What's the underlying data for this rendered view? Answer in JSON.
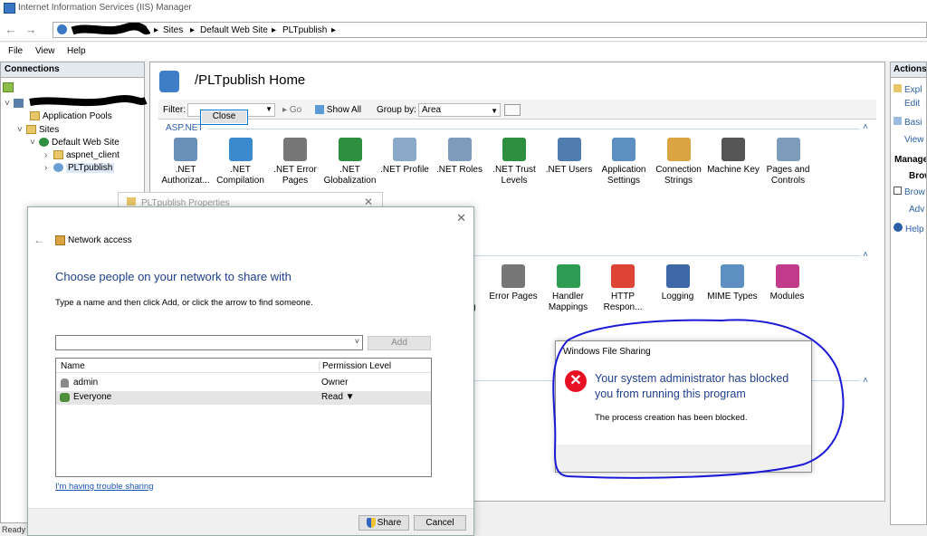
{
  "window": {
    "title": "Internet Information Services (IIS) Manager"
  },
  "address": {
    "crumbs": [
      "Sites",
      "Default Web Site",
      "PLTpublish"
    ]
  },
  "menu": [
    "File",
    "View",
    "Help"
  ],
  "connections": {
    "header": "Connections",
    "tree": [
      {
        "label": "Application Pools"
      },
      {
        "label": "Sites"
      },
      {
        "label": "Default Web Site"
      },
      {
        "label": "aspnet_client"
      },
      {
        "label": "PLTpublish"
      }
    ]
  },
  "main": {
    "title": "/PLTpublish Home",
    "filter_label": "Filter:",
    "go_label": "Go",
    "show_all_label": "Show All",
    "group_by_label": "Group by:",
    "group_by_value": "Area",
    "section_aspnet": "ASP.NET",
    "aspnet_features": [
      {
        "label": ".NET Authorizat...",
        "icon": "lock-user-icon"
      },
      {
        "label": ".NET Compilation",
        "icon": "download-arrow-icon"
      },
      {
        "label": ".NET Error Pages",
        "icon": "error-404-icon"
      },
      {
        "label": ".NET Globalization",
        "icon": "globe-icon"
      },
      {
        "label": ".NET Profile",
        "icon": "profile-icon"
      },
      {
        "label": ".NET Roles",
        "icon": "roles-icon"
      },
      {
        "label": ".NET Trust Levels",
        "icon": "trust-check-icon"
      },
      {
        "label": ".NET Users",
        "icon": "users-icon"
      },
      {
        "label": "Application Settings",
        "icon": "settings-list-icon"
      },
      {
        "label": "Connection Strings",
        "icon": "database-icon"
      },
      {
        "label": "Machine Key",
        "icon": "server-key-icon"
      },
      {
        "label": "Pages and Controls",
        "icon": "pages-icon"
      }
    ],
    "iis_features": [
      {
        "label": "Error Pages",
        "icon": "error-404-icon"
      },
      {
        "label": "Handler Mappings",
        "icon": "handler-icon"
      },
      {
        "label": "HTTP Respon...",
        "icon": "http-response-icon"
      },
      {
        "label": "Logging",
        "icon": "logging-icon"
      },
      {
        "label": "MIME Types",
        "icon": "mime-icon"
      },
      {
        "label": "Modules",
        "icon": "modules-icon"
      }
    ],
    "partial_labels": [
      "y",
      "g"
    ]
  },
  "actions": {
    "header": "Actions",
    "items": [
      "Expl",
      "Edit",
      "Basi",
      "View"
    ],
    "manage_header": "Manage",
    "browse_header": "Brow",
    "browse_items": [
      "Brow",
      "Adv"
    ],
    "help": "Help"
  },
  "statusbar": "Ready",
  "props_dialog": {
    "title": "PLTpublish Properties"
  },
  "network_access": {
    "title": "Network access",
    "heading": "Choose people on your network to share with",
    "instructions": "Type a name and then click Add, or click the arrow to find someone.",
    "add_label": "Add",
    "col_name": "Name",
    "col_permission": "Permission Level",
    "rows": [
      {
        "name": "admin",
        "permission": "Owner"
      },
      {
        "name": "Everyone",
        "permission": "Read"
      }
    ],
    "trouble_link": "I'm having trouble sharing",
    "share_label": "Share",
    "cancel_label": "Cancel"
  },
  "file_sharing": {
    "title": "Windows File Sharing",
    "heading": "Your system administrator has blocked you from running this program",
    "message": "The process creation has been blocked.",
    "close_label": "Close"
  },
  "colors": {
    "accent": "#2b5fa6",
    "error": "#e81123",
    "annotation": "#1a1ad6"
  }
}
